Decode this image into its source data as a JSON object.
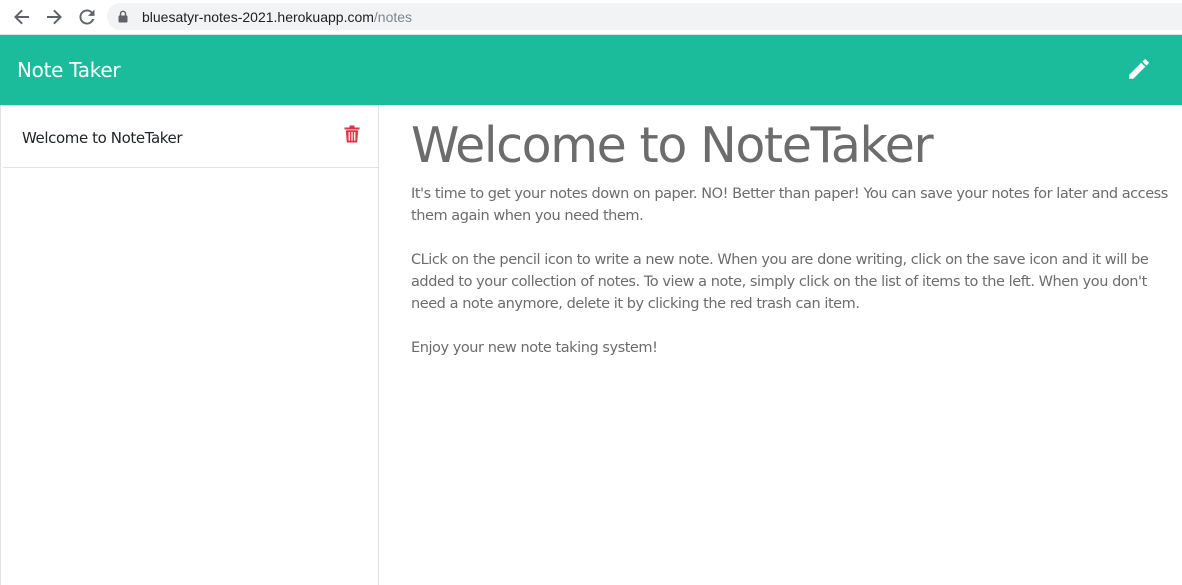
{
  "browser": {
    "url_host": "bluesatyr-notes-2021.herokuapp.com",
    "url_path": "/notes"
  },
  "header": {
    "title": "Note Taker",
    "new_note_icon": "pencil-icon",
    "background": "#1abc9c"
  },
  "sidebar": {
    "notes": [
      {
        "title": "Welcome to NoteTaker",
        "delete_icon": "trash-icon",
        "delete_color": "#dc3545"
      }
    ]
  },
  "note": {
    "title": "Welcome to NoteTaker",
    "paragraphs": [
      "It's time to get your notes down on paper. NO! Better than paper!  You can save your notes for later and access them again when you need them.",
      "CLick on the pencil icon to write a new note. When you are done writing, click on the save icon and it will be added to your collection of notes. To view a note, simply click on the list of items to the left. When you don't need a note anymore, delete it by clicking the red trash can item.",
      "Enjoy your new note taking system!"
    ]
  }
}
